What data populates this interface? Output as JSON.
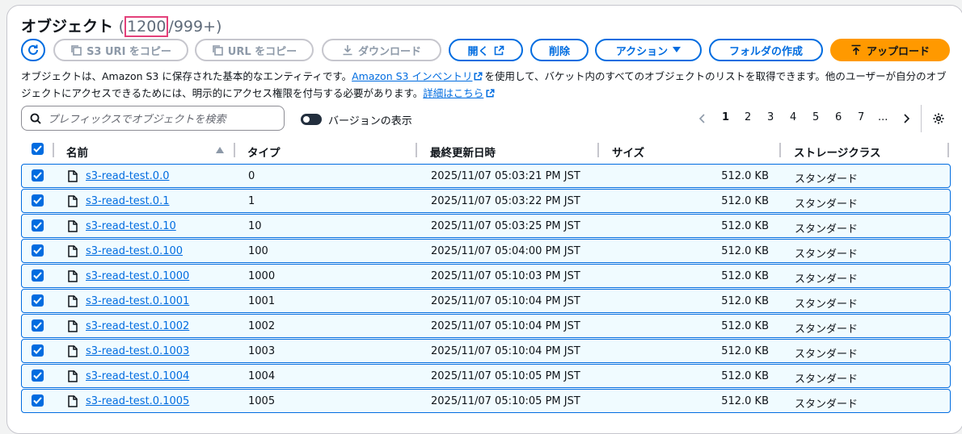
{
  "header": {
    "title": "オブジェクト",
    "count_open": "(",
    "count_highlight": "1200",
    "count_rest": "/999+)"
  },
  "toolbar": {
    "refresh_icon": "refresh-icon",
    "copy_s3_uri": "S3 URI をコピー",
    "copy_url": "URL をコピー",
    "download": "ダウンロード",
    "open": "開く",
    "delete": "削除",
    "actions": "アクション",
    "create_folder": "フォルダの作成",
    "upload": "アップロード"
  },
  "description": {
    "part1": "オブジェクトは、Amazon S3 に保存された基本的なエンティティです。",
    "inventory_link": "Amazon S3 インベントリ",
    "part2": "を使用して、バケット内のすべてのオブジェクトのリストを取得できます。他のユーザーが自分のオブジェクトにアクセスできるためには、明示的にアクセス権限を付与する必要があります。",
    "details_link": "詳細はこちら"
  },
  "search": {
    "placeholder": "プレフィックスでオブジェクトを検索"
  },
  "versions_toggle": {
    "label": "バージョンの表示",
    "on": false
  },
  "pagination": {
    "pages": [
      "1",
      "2",
      "3",
      "4",
      "5",
      "6",
      "7",
      "..."
    ],
    "current": "1"
  },
  "table": {
    "columns": [
      "名前",
      "タイプ",
      "最終更新日時",
      "サイズ",
      "ストレージクラス"
    ],
    "rows": [
      {
        "name": "s3-read-test.0.0",
        "type": "0",
        "modified": "2025/11/07 05:03:21 PM JST",
        "size": "512.0 KB",
        "storage": "スタンダード"
      },
      {
        "name": "s3-read-test.0.1",
        "type": "1",
        "modified": "2025/11/07 05:03:22 PM JST",
        "size": "512.0 KB",
        "storage": "スタンダード"
      },
      {
        "name": "s3-read-test.0.10",
        "type": "10",
        "modified": "2025/11/07 05:03:25 PM JST",
        "size": "512.0 KB",
        "storage": "スタンダード"
      },
      {
        "name": "s3-read-test.0.100",
        "type": "100",
        "modified": "2025/11/07 05:04:00 PM JST",
        "size": "512.0 KB",
        "storage": "スタンダード"
      },
      {
        "name": "s3-read-test.0.1000",
        "type": "1000",
        "modified": "2025/11/07 05:10:03 PM JST",
        "size": "512.0 KB",
        "storage": "スタンダード"
      },
      {
        "name": "s3-read-test.0.1001",
        "type": "1001",
        "modified": "2025/11/07 05:10:04 PM JST",
        "size": "512.0 KB",
        "storage": "スタンダード"
      },
      {
        "name": "s3-read-test.0.1002",
        "type": "1002",
        "modified": "2025/11/07 05:10:04 PM JST",
        "size": "512.0 KB",
        "storage": "スタンダード"
      },
      {
        "name": "s3-read-test.0.1003",
        "type": "1003",
        "modified": "2025/11/07 05:10:04 PM JST",
        "size": "512.0 KB",
        "storage": "スタンダード"
      },
      {
        "name": "s3-read-test.0.1004",
        "type": "1004",
        "modified": "2025/11/07 05:10:05 PM JST",
        "size": "512.0 KB",
        "storage": "スタンダード"
      },
      {
        "name": "s3-read-test.0.1005",
        "type": "1005",
        "modified": "2025/11/07 05:10:05 PM JST",
        "size": "512.0 KB",
        "storage": "スタンダード"
      }
    ]
  },
  "colors": {
    "accent": "#006ce0",
    "primary": "#ff9900",
    "highlight_box": "#e3407a",
    "row_selected_bg": "#f0fbff"
  }
}
